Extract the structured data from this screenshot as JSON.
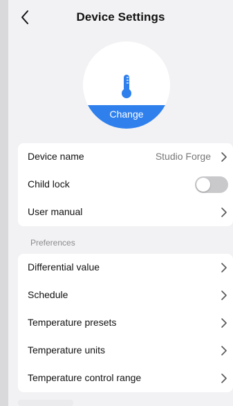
{
  "header": {
    "title": "Device Settings"
  },
  "avatar": {
    "icon": "thermometer-icon",
    "change_label": "Change",
    "accent": "#2f80ed"
  },
  "general": {
    "rows": [
      {
        "label": "Device name",
        "value": "Studio Forge"
      },
      {
        "label": "Child lock",
        "toggle": false
      },
      {
        "label": "User manual"
      }
    ]
  },
  "preferences": {
    "header": "Preferences",
    "rows": [
      {
        "label": "Differential value"
      },
      {
        "label": "Schedule"
      },
      {
        "label": "Temperature presets"
      },
      {
        "label": "Temperature units"
      },
      {
        "label": "Temperature control range"
      }
    ]
  }
}
